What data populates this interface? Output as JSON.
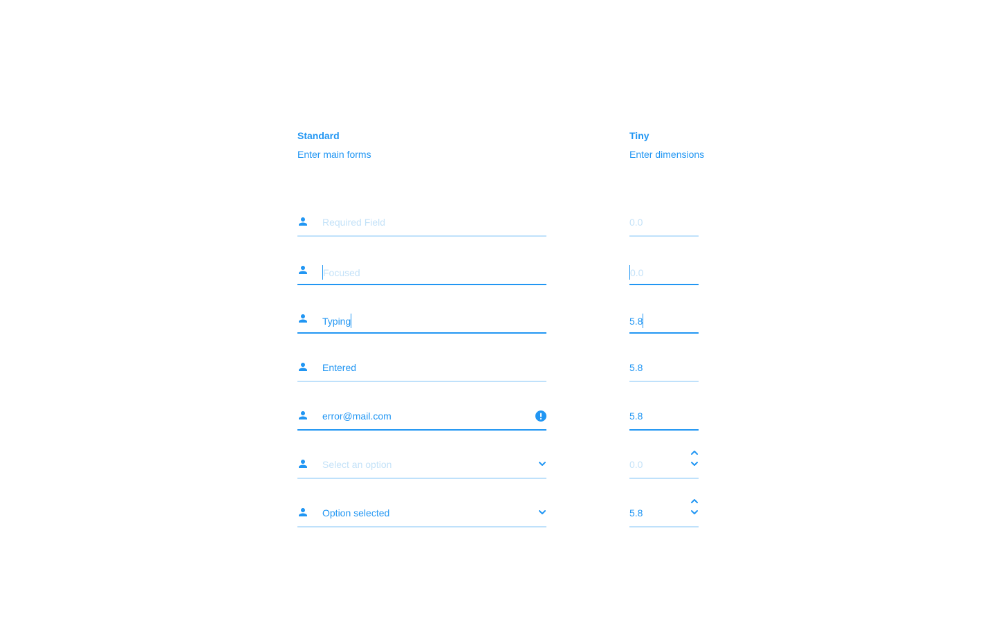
{
  "standard": {
    "title": "Standard",
    "subtitle": "Enter main forms",
    "fields": {
      "required": {
        "placeholder": "Required Field"
      },
      "focused": {
        "placeholder": "Focused"
      },
      "typing": {
        "value": "Typing"
      },
      "entered": {
        "value": "Entered"
      },
      "error": {
        "value": "error@mail.com"
      },
      "select_empty": {
        "placeholder": "Select an option"
      },
      "select_filled": {
        "value": "Option selected"
      }
    }
  },
  "tiny": {
    "title": "Tiny",
    "subtitle": "Enter dimensions",
    "fields": {
      "required": {
        "placeholder": "0.0"
      },
      "focused": {
        "placeholder": "0.0"
      },
      "typing": {
        "value": "5.8"
      },
      "entered": {
        "value": "5.8"
      },
      "error": {
        "value": "5.8"
      },
      "stepper_empty": {
        "placeholder": "0.0"
      },
      "stepper_filled": {
        "value": "5.8"
      }
    }
  },
  "icons": {
    "field_icon": "person-icon",
    "error_icon": "alert-icon",
    "select_icon": "chevron-down-icon",
    "stepper_up": "chevron-up-icon",
    "stepper_down": "chevron-down-icon"
  },
  "colors": {
    "accent": "#2196f3",
    "placeholder": "#c4e2f8",
    "underline_idle": "#bfe1fb",
    "background": "#ffffff"
  }
}
